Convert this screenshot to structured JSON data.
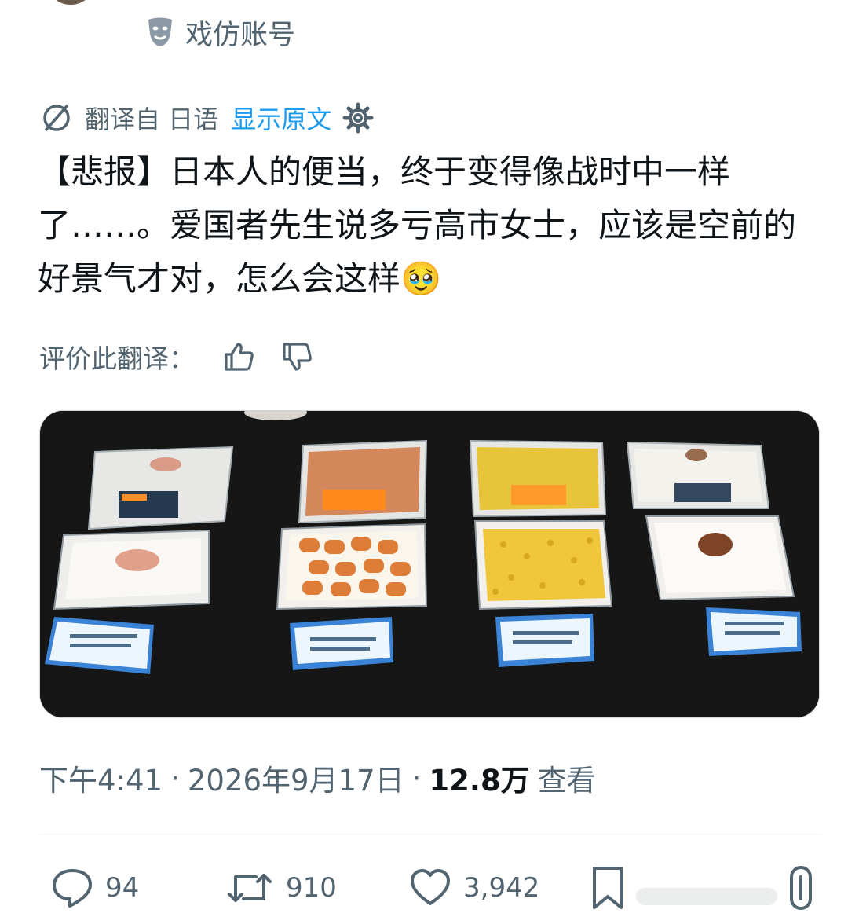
{
  "account": {
    "parody_label": "戏仿账号",
    "icon": "theater-mask-icon"
  },
  "translation": {
    "translated_from": "翻译自 日语",
    "show_original": "显示原文",
    "rate_label": "评价此翻译：",
    "icons": [
      "translate-icon",
      "gear-icon",
      "thumbs-up-icon",
      "thumbs-down-icon"
    ]
  },
  "post": {
    "text": "【悲报】日本人的便当，终于变得像战时中一样了……。爱国者先生说多亏高市女士，应该是空前的好景气才对，怎么会这样🥹",
    "image": "Four lunch-box rice bowls on a dark tablecloth: rice with a small topping, sausages on rice, corn on rice, and rice with a meat patty, each with a blue price card in front"
  },
  "meta": {
    "time": "下午4:41",
    "date": "2026年9月17日",
    "separator": "·",
    "views_count": "12.8万",
    "views_label": "查看"
  },
  "actions": {
    "replies": "94",
    "reposts": "910",
    "likes": "3,942"
  },
  "colors": {
    "accent": "#1d9bf0",
    "secondary_text": "#536471",
    "text": "#0f1419"
  }
}
